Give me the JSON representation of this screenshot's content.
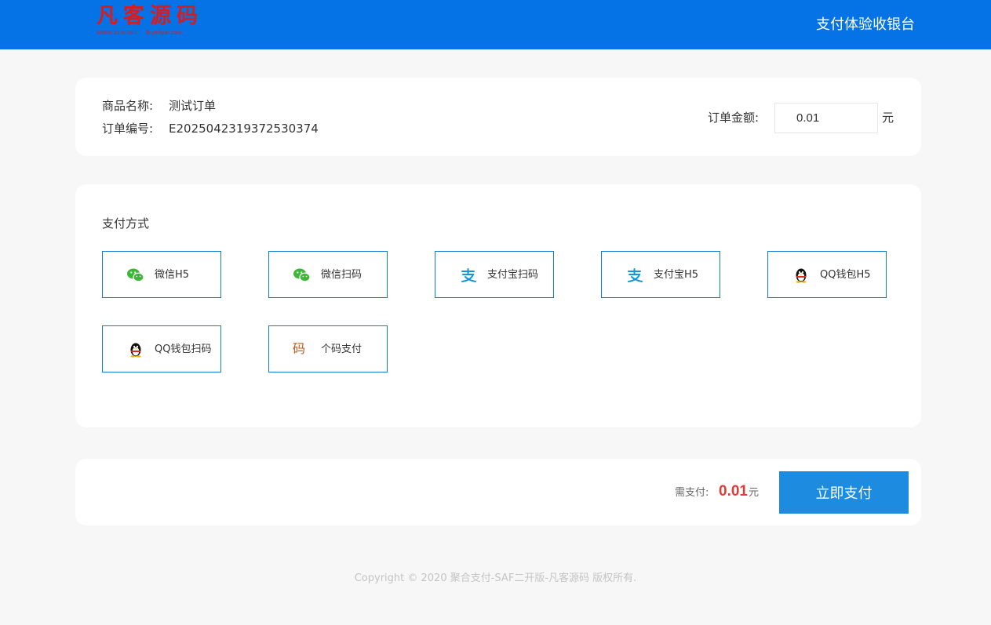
{
  "header": {
    "logo_text": "凡客源码",
    "logo_sub_left": "WWW.2016.NET",
    "logo_sub_right": "fk.ymfyun.com",
    "title": "支付体验收银台"
  },
  "order": {
    "name_label": "商品名称:",
    "name_value": "测试订单",
    "number_label": "订单编号:",
    "number_value": "E2025042319372530374",
    "amount_label": "订单金额:",
    "amount_value": "0.01",
    "amount_unit": "元"
  },
  "methods": {
    "title": "支付方式",
    "items": [
      {
        "label": "微信H5",
        "icon": "wechat-icon"
      },
      {
        "label": "微信扫码",
        "icon": "wechat-icon"
      },
      {
        "label": "支付宝扫码",
        "icon": "alipay-icon"
      },
      {
        "label": "支付宝H5",
        "icon": "alipay-icon"
      },
      {
        "label": "QQ钱包H5",
        "icon": "qq-penguin-icon"
      },
      {
        "label": "QQ钱包扫码",
        "icon": "qq-penguin-icon"
      },
      {
        "label": "个码支付",
        "icon": "code-glyph-icon",
        "icon_text": "码"
      }
    ]
  },
  "pay": {
    "need_label": "需支付:",
    "need_amount": "0.01",
    "need_unit": "元",
    "button_label": "立即支付"
  },
  "footer": {
    "copyright": "Copyright © 2020 聚合支付-SAF二开版-凡客源码 版权所有."
  },
  "colors": {
    "header_bg": "#0573e6",
    "accent": "#1d8ce0",
    "price": "#e53935",
    "wechat": "#3fb53a",
    "alipay": "#1296db",
    "code_glyph": "#c25a1a"
  }
}
